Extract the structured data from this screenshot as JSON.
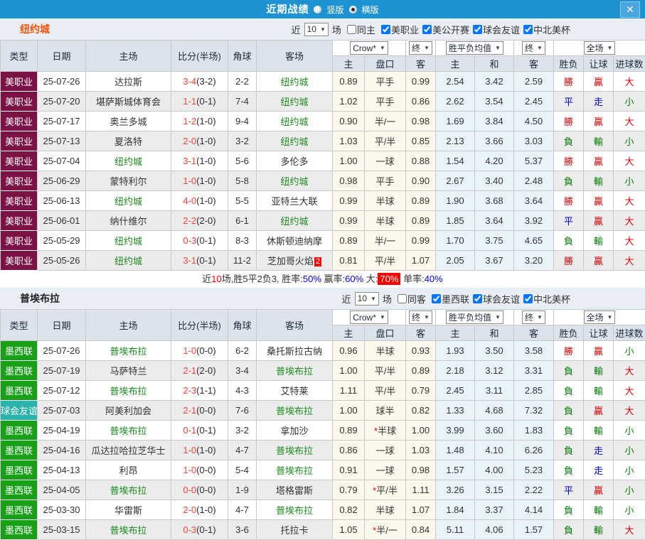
{
  "titlebar": {
    "title": "近期战绩",
    "vertical_label": "竖版",
    "horizontal_label": "横版",
    "selected_layout": "横版",
    "close_glyph": "✕"
  },
  "colors": {
    "titlebar_blue": "#1e93d2",
    "league_mls": "#7a1245",
    "league_mex": "#18a018",
    "league_friendly": "#2ab3ab",
    "team_highlight_green": "#1a8c1a",
    "score_red": "#ff4433"
  },
  "sections": [
    {
      "team": "纽约城",
      "near_label": "近",
      "count": "10",
      "games_label": "场",
      "same": {
        "label": "同主",
        "checked": false
      },
      "leagues": [
        {
          "label": "美职业",
          "checked": true
        },
        {
          "label": "美公开赛",
          "checked": true
        },
        {
          "label": "球会友谊",
          "checked": true
        },
        {
          "label": "中北美杯",
          "checked": true
        }
      ],
      "header": {
        "type": "类型",
        "date": "日期",
        "home": "主场",
        "score": "比分(半场)",
        "corner": "角球",
        "away": "客场",
        "company": "Crow*",
        "final1": "终",
        "avg": "胜平负均值",
        "final2": "终",
        "fulltime": "全场",
        "sub": [
          "主",
          "盘口",
          "客",
          "主",
          "和",
          "客",
          "胜负",
          "让球",
          "进球数"
        ]
      },
      "rows": [
        {
          "type": "美职业",
          "tbg": "maroon",
          "date": "25-07-26",
          "home": "达拉斯",
          "hg": false,
          "score": "3-4",
          "half": "(3-2)",
          "corner": "2-2",
          "away": "纽约城",
          "ag": true,
          "badge": "",
          "o1": "0.89",
          "star": false,
          "hc": "平手",
          "o2": "0.99",
          "a1": "2.54",
          "a2": "3.42",
          "a3": "2.59",
          "r1": "勝",
          "c1": "red",
          "r2": "贏",
          "c2": "red",
          "r3": "大",
          "c3": "red"
        },
        {
          "type": "美职业",
          "tbg": "maroon",
          "date": "25-07-20",
          "home": "堪萨斯城体育会",
          "hg": false,
          "score": "1-1",
          "half": "(0-1)",
          "corner": "7-4",
          "away": "纽约城",
          "ag": true,
          "badge": "",
          "o1": "1.02",
          "star": false,
          "hc": "平手",
          "o2": "0.86",
          "a1": "2.62",
          "a2": "3.54",
          "a3": "2.45",
          "r1": "平",
          "c1": "blue",
          "r2": "走",
          "c2": "blue",
          "r3": "小",
          "c3": "green"
        },
        {
          "type": "美职业",
          "tbg": "maroon",
          "date": "25-07-17",
          "home": "奥兰多城",
          "hg": false,
          "score": "1-2",
          "half": "(1-0)",
          "corner": "9-4",
          "away": "纽约城",
          "ag": true,
          "badge": "",
          "o1": "0.90",
          "star": false,
          "hc": "半/一",
          "o2": "0.98",
          "a1": "1.69",
          "a2": "3.84",
          "a3": "4.50",
          "r1": "勝",
          "c1": "red",
          "r2": "贏",
          "c2": "red",
          "r3": "大",
          "c3": "red"
        },
        {
          "type": "美职业",
          "tbg": "maroon",
          "date": "25-07-13",
          "home": "夏洛特",
          "hg": false,
          "score": "2-0",
          "half": "(1-0)",
          "corner": "3-2",
          "away": "纽约城",
          "ag": true,
          "badge": "",
          "o1": "1.03",
          "star": false,
          "hc": "平/半",
          "o2": "0.85",
          "a1": "2.13",
          "a2": "3.66",
          "a3": "3.03",
          "r1": "負",
          "c1": "green",
          "r2": "輸",
          "c2": "green",
          "r3": "小",
          "c3": "green"
        },
        {
          "type": "美职业",
          "tbg": "maroon",
          "date": "25-07-04",
          "home": "纽约城",
          "hg": true,
          "score": "3-1",
          "half": "(1-0)",
          "corner": "5-6",
          "away": "多伦多",
          "ag": false,
          "badge": "",
          "o1": "1.00",
          "star": false,
          "hc": "一球",
          "o2": "0.88",
          "a1": "1.54",
          "a2": "4.20",
          "a3": "5.37",
          "r1": "勝",
          "c1": "red",
          "r2": "贏",
          "c2": "red",
          "r3": "大",
          "c3": "red"
        },
        {
          "type": "美职业",
          "tbg": "maroon",
          "date": "25-06-29",
          "home": "蒙特利尔",
          "hg": false,
          "score": "1-0",
          "half": "(1-0)",
          "corner": "5-8",
          "away": "纽约城",
          "ag": true,
          "badge": "",
          "o1": "0.98",
          "star": false,
          "hc": "平手",
          "o2": "0.90",
          "a1": "2.67",
          "a2": "3.40",
          "a3": "2.48",
          "r1": "負",
          "c1": "green",
          "r2": "輸",
          "c2": "green",
          "r3": "小",
          "c3": "green"
        },
        {
          "type": "美职业",
          "tbg": "maroon",
          "date": "25-06-13",
          "home": "纽约城",
          "hg": true,
          "score": "4-0",
          "half": "(1-0)",
          "corner": "5-5",
          "away": "亚特兰大联",
          "ag": false,
          "badge": "",
          "o1": "0.99",
          "star": false,
          "hc": "半球",
          "o2": "0.89",
          "a1": "1.90",
          "a2": "3.68",
          "a3": "3.64",
          "r1": "勝",
          "c1": "red",
          "r2": "贏",
          "c2": "red",
          "r3": "大",
          "c3": "red"
        },
        {
          "type": "美职业",
          "tbg": "maroon",
          "date": "25-06-01",
          "home": "纳什维尔",
          "hg": false,
          "score": "2-2",
          "half": "(2-0)",
          "corner": "6-1",
          "away": "纽约城",
          "ag": true,
          "badge": "",
          "o1": "0.99",
          "star": false,
          "hc": "半球",
          "o2": "0.89",
          "a1": "1.85",
          "a2": "3.64",
          "a3": "3.92",
          "r1": "平",
          "c1": "blue",
          "r2": "贏",
          "c2": "red",
          "r3": "大",
          "c3": "red"
        },
        {
          "type": "美职业",
          "tbg": "maroon",
          "date": "25-05-29",
          "home": "纽约城",
          "hg": true,
          "score": "0-3",
          "half": "(0-1)",
          "corner": "8-3",
          "away": "休斯顿迪纳摩",
          "ag": false,
          "badge": "",
          "o1": "0.89",
          "star": false,
          "hc": "半/一",
          "o2": "0.99",
          "a1": "1.70",
          "a2": "3.75",
          "a3": "4.65",
          "r1": "負",
          "c1": "green",
          "r2": "輸",
          "c2": "green",
          "r3": "大",
          "c3": "red"
        },
        {
          "type": "美职业",
          "tbg": "maroon",
          "date": "25-05-26",
          "home": "纽约城",
          "hg": true,
          "score": "3-1",
          "half": "(0-1)",
          "corner": "11-2",
          "away": "芝加哥火焰",
          "ag": false,
          "badge": "2",
          "o1": "0.81",
          "star": false,
          "hc": "平/半",
          "o2": "1.07",
          "a1": "2.05",
          "a2": "3.67",
          "a3": "3.20",
          "r1": "勝",
          "c1": "red",
          "r2": "贏",
          "c2": "red",
          "r3": "大",
          "c3": "red"
        }
      ],
      "summary": [
        {
          "t": "近",
          "c": "dark"
        },
        {
          "t": "10",
          "c": "red"
        },
        {
          "t": "场,胜5平2负3, 胜率:",
          "c": "dark"
        },
        {
          "t": "50%",
          "c": "blue"
        },
        {
          "t": " 赢率:",
          "c": "dark"
        },
        {
          "t": "60%",
          "c": "blue"
        },
        {
          "t": " 大:",
          "c": "dark"
        },
        {
          "t": "70%",
          "c": "badge"
        },
        {
          "t": " 单率:",
          "c": "dark"
        },
        {
          "t": "40%",
          "c": "blue"
        }
      ]
    },
    {
      "team": "普埃布拉",
      "near_label": "近",
      "count": "10",
      "games_label": "场",
      "same": {
        "label": "同客",
        "checked": false
      },
      "leagues": [
        {
          "label": "墨西联",
          "checked": true
        },
        {
          "label": "球会友谊",
          "checked": true
        },
        {
          "label": "中北美杯",
          "checked": true
        }
      ],
      "header": {
        "type": "类型",
        "date": "日期",
        "home": "主场",
        "score": "比分(半场)",
        "corner": "角球",
        "away": "客场",
        "company": "Crow*",
        "final1": "终",
        "avg": "胜平负均值",
        "final2": "终",
        "fulltime": "全场",
        "sub": [
          "主",
          "盘口",
          "客",
          "主",
          "和",
          "客",
          "胜负",
          "让球",
          "进球数"
        ]
      },
      "rows": [
        {
          "type": "墨西联",
          "tbg": "green",
          "date": "25-07-26",
          "home": "普埃布拉",
          "hg": true,
          "score": "1-0",
          "half": "(0-0)",
          "corner": "6-2",
          "away": "桑托斯拉古纳",
          "ag": false,
          "badge": "",
          "o1": "0.96",
          "star": false,
          "hc": "半球",
          "o2": "0.93",
          "a1": "1.93",
          "a2": "3.50",
          "a3": "3.58",
          "r1": "勝",
          "c1": "red",
          "r2": "贏",
          "c2": "red",
          "r3": "小",
          "c3": "green"
        },
        {
          "type": "墨西联",
          "tbg": "green",
          "date": "25-07-19",
          "home": "马萨特兰",
          "hg": false,
          "score": "2-1",
          "half": "(2-0)",
          "corner": "3-4",
          "away": "普埃布拉",
          "ag": true,
          "badge": "",
          "o1": "1.00",
          "star": false,
          "hc": "平/半",
          "o2": "0.89",
          "a1": "2.18",
          "a2": "3.12",
          "a3": "3.31",
          "r1": "負",
          "c1": "green",
          "r2": "輸",
          "c2": "green",
          "r3": "大",
          "c3": "red"
        },
        {
          "type": "墨西联",
          "tbg": "green",
          "date": "25-07-12",
          "home": "普埃布拉",
          "hg": true,
          "score": "2-3",
          "half": "(1-1)",
          "corner": "4-3",
          "away": "艾特莱",
          "ag": false,
          "badge": "",
          "o1": "1.11",
          "star": false,
          "hc": "平/半",
          "o2": "0.79",
          "a1": "2.45",
          "a2": "3.11",
          "a3": "2.85",
          "r1": "負",
          "c1": "green",
          "r2": "輸",
          "c2": "green",
          "r3": "大",
          "c3": "red"
        },
        {
          "type": "球会友谊",
          "tbg": "teal",
          "date": "25-07-03",
          "home": "阿美利加会",
          "hg": false,
          "score": "2-1",
          "half": "(0-0)",
          "corner": "7-6",
          "away": "普埃布拉",
          "ag": true,
          "badge": "",
          "o1": "1.00",
          "star": false,
          "hc": "球半",
          "o2": "0.82",
          "a1": "1.33",
          "a2": "4.68",
          "a3": "7.32",
          "r1": "負",
          "c1": "green",
          "r2": "贏",
          "c2": "red",
          "r3": "大",
          "c3": "red"
        },
        {
          "type": "墨西联",
          "tbg": "green",
          "date": "25-04-19",
          "home": "普埃布拉",
          "hg": true,
          "score": "0-1",
          "half": "(0-1)",
          "corner": "3-2",
          "away": "拿加沙",
          "ag": false,
          "badge": "",
          "o1": "0.89",
          "star": true,
          "hc": "半球",
          "o2": "1.00",
          "a1": "3.99",
          "a2": "3.60",
          "a3": "1.83",
          "r1": "負",
          "c1": "green",
          "r2": "輸",
          "c2": "green",
          "r3": "小",
          "c3": "green"
        },
        {
          "type": "墨西联",
          "tbg": "green",
          "date": "25-04-16",
          "home": "瓜达拉哈拉芝华士",
          "hg": false,
          "score": "1-0",
          "half": "(1-0)",
          "corner": "4-7",
          "away": "普埃布拉",
          "ag": true,
          "badge": "",
          "o1": "0.86",
          "star": false,
          "hc": "一球",
          "o2": "1.03",
          "a1": "1.48",
          "a2": "4.10",
          "a3": "6.26",
          "r1": "負",
          "c1": "green",
          "r2": "走",
          "c2": "blue",
          "r3": "小",
          "c3": "green"
        },
        {
          "type": "墨西联",
          "tbg": "green",
          "date": "25-04-13",
          "home": "利昂",
          "hg": false,
          "score": "1-0",
          "half": "(0-0)",
          "corner": "5-4",
          "away": "普埃布拉",
          "ag": true,
          "badge": "",
          "o1": "0.91",
          "star": false,
          "hc": "一球",
          "o2": "0.98",
          "a1": "1.57",
          "a2": "4.00",
          "a3": "5.23",
          "r1": "負",
          "c1": "green",
          "r2": "走",
          "c2": "blue",
          "r3": "小",
          "c3": "green"
        },
        {
          "type": "墨西联",
          "tbg": "green",
          "date": "25-04-05",
          "home": "普埃布拉",
          "hg": true,
          "score": "0-0",
          "half": "(0-0)",
          "corner": "1-9",
          "away": "塔格雷斯",
          "ag": false,
          "badge": "",
          "o1": "0.79",
          "star": true,
          "hc": "平/半",
          "o2": "1.11",
          "a1": "3.26",
          "a2": "3.15",
          "a3": "2.22",
          "r1": "平",
          "c1": "blue",
          "r2": "贏",
          "c2": "red",
          "r3": "小",
          "c3": "green"
        },
        {
          "type": "墨西联",
          "tbg": "green",
          "date": "25-03-30",
          "home": "华雷斯",
          "hg": false,
          "score": "2-0",
          "half": "(1-0)",
          "corner": "4-7",
          "away": "普埃布拉",
          "ag": true,
          "badge": "",
          "o1": "0.82",
          "star": false,
          "hc": "半球",
          "o2": "1.07",
          "a1": "1.84",
          "a2": "3.37",
          "a3": "4.14",
          "r1": "負",
          "c1": "green",
          "r2": "輸",
          "c2": "green",
          "r3": "小",
          "c3": "green"
        },
        {
          "type": "墨西联",
          "tbg": "green",
          "date": "25-03-15",
          "home": "普埃布拉",
          "hg": true,
          "score": "0-3",
          "half": "(0-1)",
          "corner": "3-6",
          "away": "托拉卡",
          "ag": false,
          "badge": "",
          "o1": "1.05",
          "star": true,
          "hc": "半/一",
          "o2": "0.84",
          "a1": "5.11",
          "a2": "4.06",
          "a3": "1.57",
          "r1": "負",
          "c1": "green",
          "r2": "輸",
          "c2": "green",
          "r3": "大",
          "c3": "red"
        }
      ]
    }
  ]
}
